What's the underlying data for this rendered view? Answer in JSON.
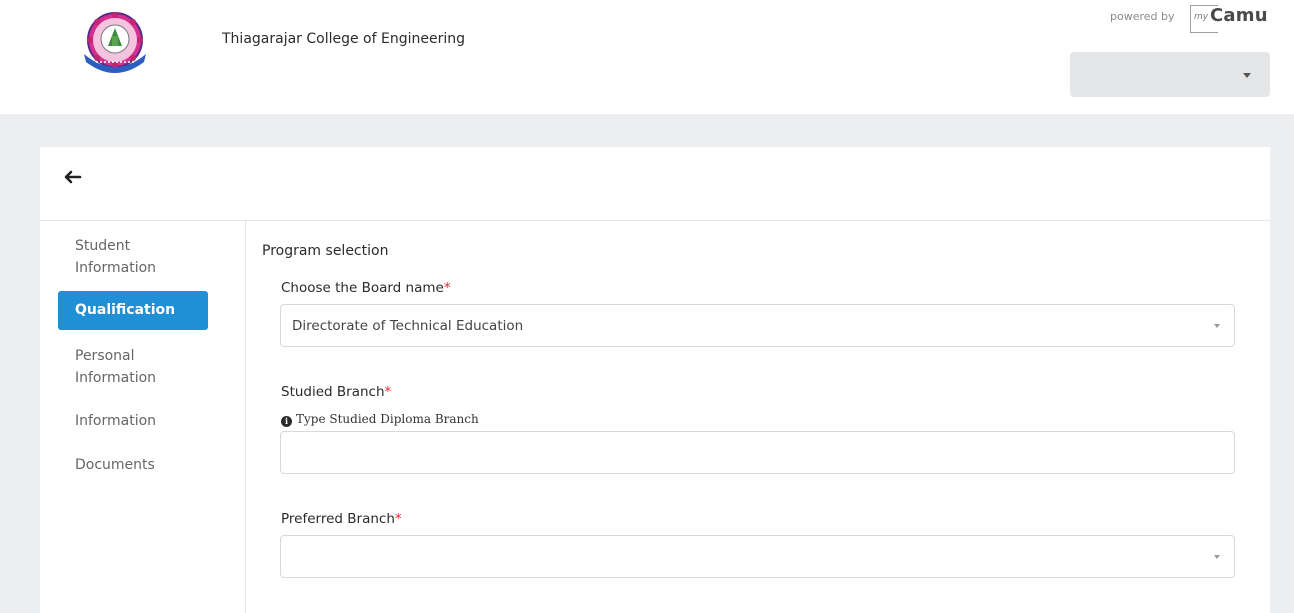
{
  "header": {
    "college_name": "Thiagarajar College of Engineering",
    "powered_by": "powered by",
    "brand_my": "my",
    "brand_camu": "Camu",
    "user_select_value": ""
  },
  "sidebar": {
    "items": [
      {
        "label": "Student Information",
        "active": false
      },
      {
        "label": "Qualification",
        "active": true
      },
      {
        "label": "Personal Information",
        "active": false
      },
      {
        "label": "Information",
        "active": false
      },
      {
        "label": "Documents",
        "active": false
      }
    ]
  },
  "form": {
    "section_title": "Program selection",
    "board": {
      "label": "Choose the Board name",
      "required_mark": "*",
      "value": "Directorate of Technical Education"
    },
    "studied_branch": {
      "label": "Studied Branch",
      "required_mark": "*",
      "hint": "Type Studied Diploma Branch",
      "value": "",
      "placeholder": ""
    },
    "preferred_branch": {
      "label": "Preferred Branch",
      "required_mark": "*",
      "value": ""
    }
  },
  "colors": {
    "accent": "#1f8fd6",
    "required": "#e0262d",
    "band": "#eceef2"
  },
  "icons": [
    "college-logo",
    "arrow-left-icon",
    "chevron-down-icon",
    "info-circle-icon"
  ]
}
